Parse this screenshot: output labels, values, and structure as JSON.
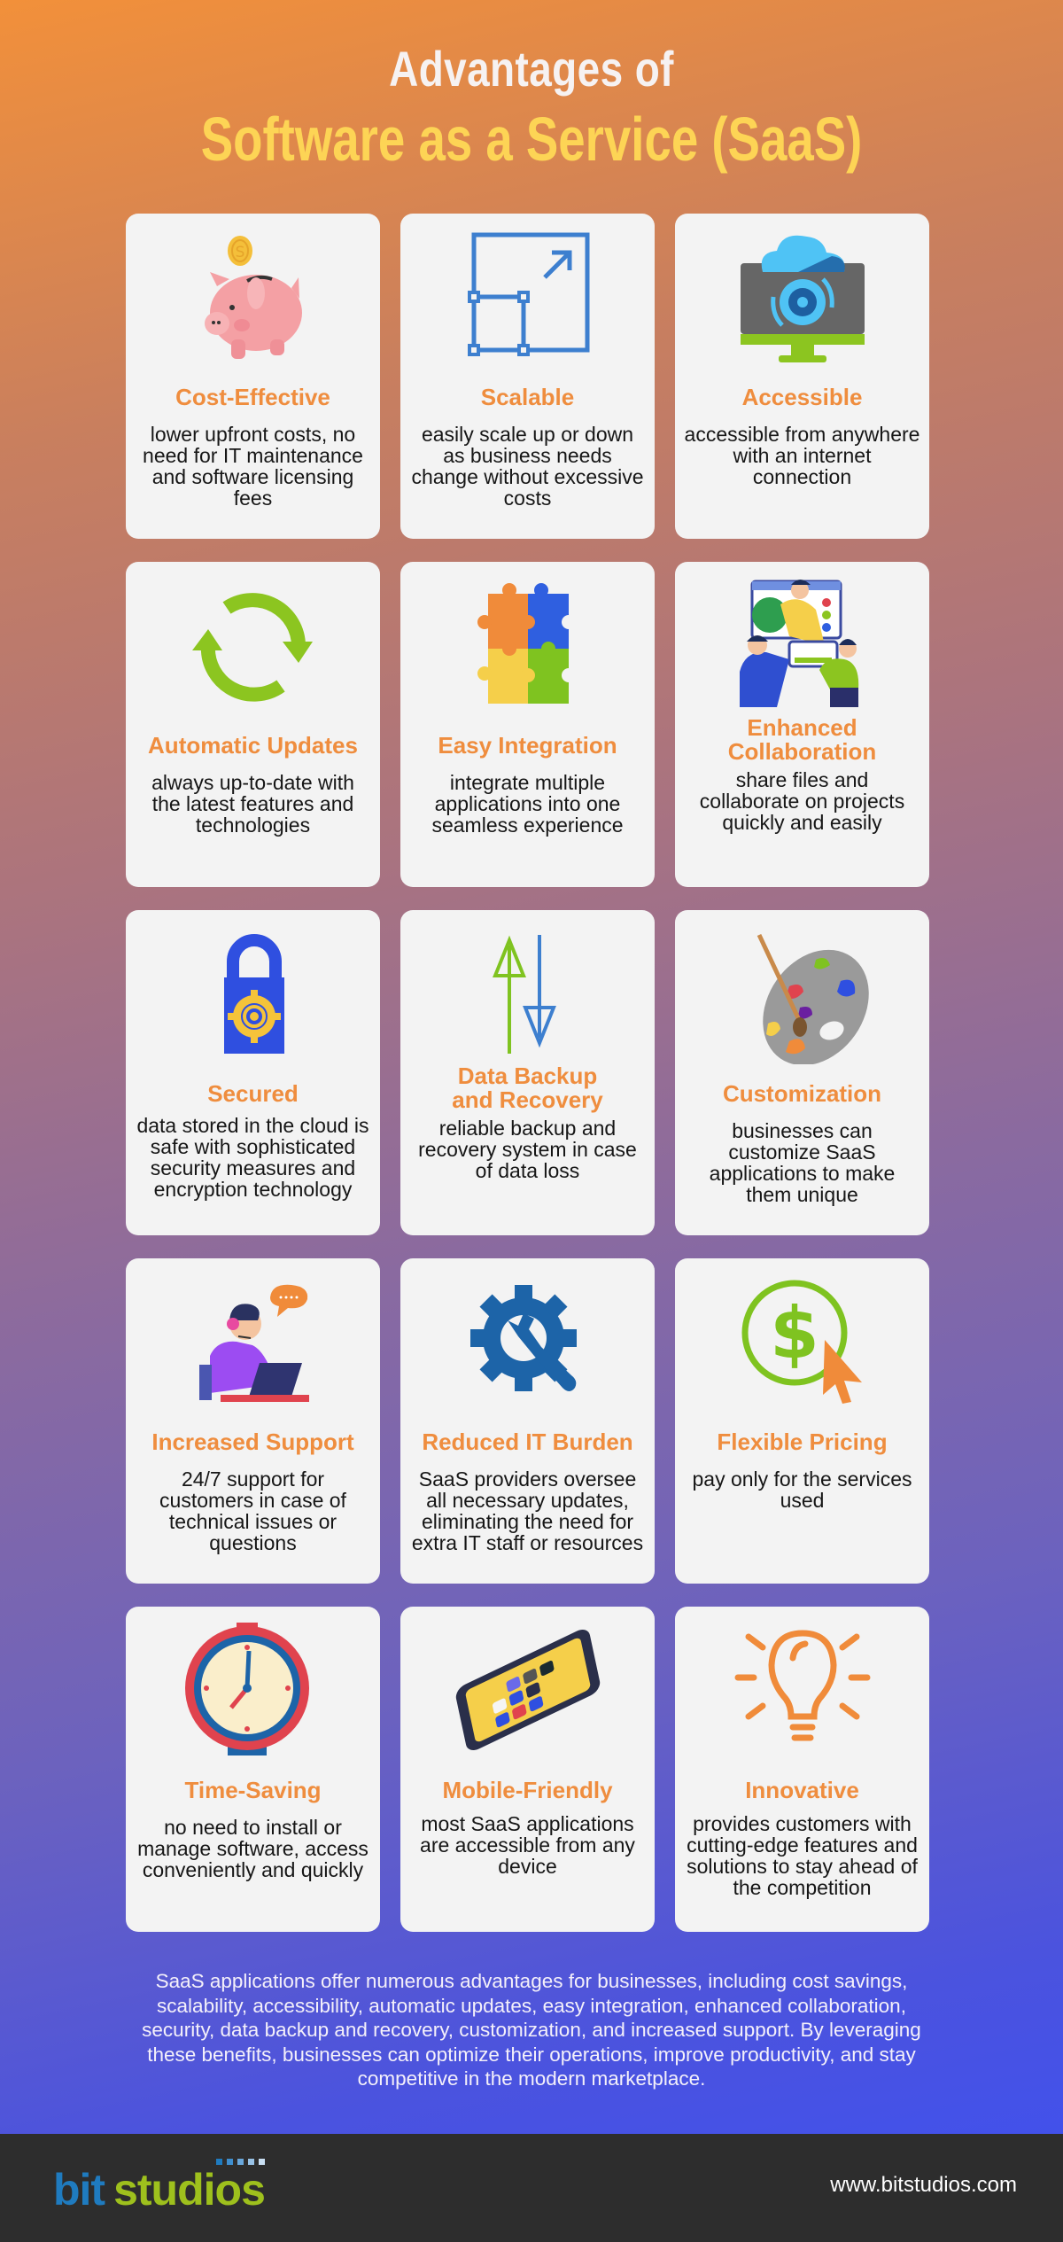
{
  "header": {
    "title_line1": "Advantages of",
    "title_line2": "Software as a Service (SaaS)"
  },
  "colors": {
    "card_title": "#ef8d3e",
    "title_yellow": "#fdd455",
    "footer_bg": "#2d2d2d",
    "logo_blue": "#1f7bbf",
    "logo_green": "#9ec01d"
  },
  "cards": [
    {
      "icon": "piggy-bank-icon",
      "title": "Cost-Effective",
      "desc": "lower upfront costs, no need for IT maintenance and software licensing fees"
    },
    {
      "icon": "scale-resize-icon",
      "title": "Scalable",
      "desc": "easily scale up or down as business needs change without excessive costs"
    },
    {
      "icon": "cloud-monitor-icon",
      "title": "Accessible",
      "desc": "accessible from anywhere with an internet connection"
    },
    {
      "icon": "refresh-arrows-icon",
      "title": "Automatic Updates",
      "desc": "always up-to-date with the latest features and technologies"
    },
    {
      "icon": "puzzle-icon",
      "title": "Easy Integration",
      "desc": "integrate multiple applications into one seamless experience"
    },
    {
      "icon": "collaboration-people-icon",
      "title": "Enhanced Collaboration",
      "desc": "share files and collaborate on projects quickly and easily"
    },
    {
      "icon": "padlock-gear-icon",
      "title": "Secured",
      "desc": "data stored in the cloud is safe with sophisticated security measures and encryption technology"
    },
    {
      "icon": "up-down-arrows-icon",
      "title": "Data Backup and Recovery",
      "desc": "reliable backup and recovery system in case of data loss"
    },
    {
      "icon": "paint-palette-icon",
      "title": "Customization",
      "desc": "businesses can customize SaaS applications to make them unique"
    },
    {
      "icon": "support-agent-icon",
      "title": "Increased Support",
      "desc": "24/7 support for customers in case of technical issues or questions"
    },
    {
      "icon": "gear-wrench-icon",
      "title": "Reduced IT Burden",
      "desc": "SaaS providers oversee all necessary updates, eliminating the need for extra IT staff or resources"
    },
    {
      "icon": "dollar-cursor-icon",
      "title": "Flexible Pricing",
      "desc": "pay only for the services used"
    },
    {
      "icon": "stopwatch-icon",
      "title": "Time-Saving",
      "desc": "no need to install or manage software, access conveniently and quickly"
    },
    {
      "icon": "smartphone-icon",
      "title": "Mobile-Friendly",
      "desc": "most SaaS applications are accessible from any device"
    },
    {
      "icon": "light-bulb-icon",
      "title": "Innovative",
      "desc": "provides customers with cutting-edge features and solutions to stay ahead of the competition"
    }
  ],
  "summary": "SaaS applications offer numerous advantages for businesses, including cost savings, scalability, accessibility, automatic updates, easy integration, enhanced collaboration, security, data backup and recovery, customization, and increased support. By leveraging these benefits, businesses can optimize their operations, improve productivity, and stay competitive in the modern marketplace.",
  "footer": {
    "logo_part1": "bit",
    "logo_part2": "studios",
    "url": "www.bitstudios.com"
  }
}
